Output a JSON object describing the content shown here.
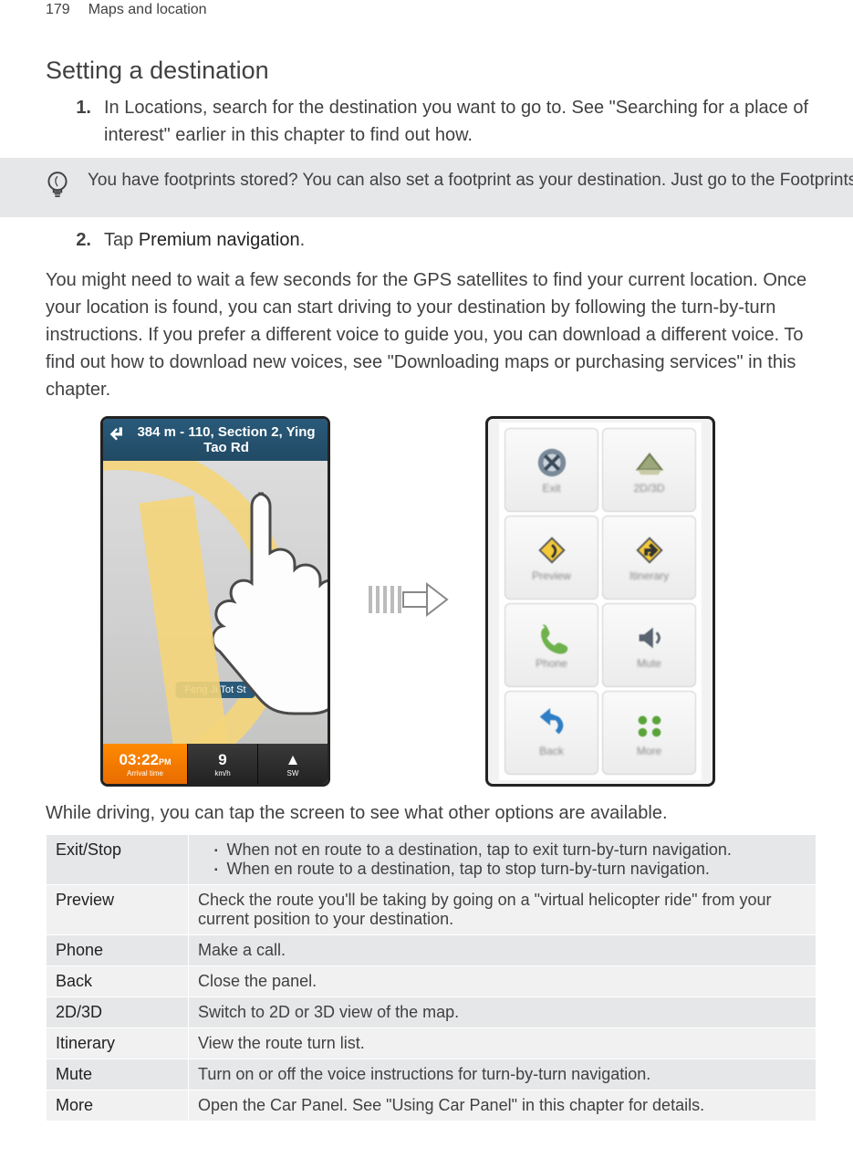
{
  "header": {
    "page_number": "179",
    "chapter": "Maps and location"
  },
  "section_title": "Setting a destination",
  "steps": {
    "s1_num": "1.",
    "s1_text": "In Locations, search for the destination you want to go to. See \"Searching for a place of interest\" earlier in this chapter to find out how.",
    "s2_num": "2.",
    "s2_text_a": "Tap ",
    "s2_text_b": "Premium navigation",
    "s2_text_c": "."
  },
  "tip": "You have footprints stored? You can also set a footprint as your destination. Just go to the Footprints tab, and then choose a footprint.",
  "body_para": "You might need to wait a few seconds for the GPS satellites to find your current location. Once your location is found, you can start driving to your destination by following the turn-by-turn instructions. If you prefer a different voice to guide you, you can download a different voice. To find out how to download new voices, see \"Downloading maps or purchasing services\" in this chapter.",
  "left_phone": {
    "direction": "384 m - 110, Section 2, Ying Tao Rd",
    "street_badge": "Feng Ji Tot St",
    "time": "03:22",
    "time_suffix": "PM",
    "time_label": "Arrival time",
    "speed_value": "9",
    "speed_label": "km/h",
    "compass_value": "▲",
    "compass_label": "SW"
  },
  "right_phone": {
    "cells": {
      "c0": "Exit",
      "c1": "2D/3D",
      "c2": "Preview",
      "c3": "Itinerary",
      "c4": "Phone",
      "c5": "Mute",
      "c6": "Back",
      "c7": "More"
    }
  },
  "caption": "While driving, you can tap the screen to see what other options are available.",
  "table": {
    "r0_label": "Exit/Stop",
    "r0_b1": "When not en route to a destination, tap to exit turn-by-turn navigation.",
    "r0_b2": "When en route to a destination, tap to stop turn-by-turn navigation.",
    "r1_label": "Preview",
    "r1_text": "Check the route you'll be taking by going on a \"virtual helicopter ride\" from your current position to your destination.",
    "r2_label": "Phone",
    "r2_text": "Make a call.",
    "r3_label": "Back",
    "r3_text": "Close the panel.",
    "r4_label": "2D/3D",
    "r4_text": "Switch to 2D or 3D view of the map.",
    "r5_label": "Itinerary",
    "r5_text": "View the route turn list.",
    "r6_label": "Mute",
    "r6_text": "Turn on or off the voice instructions for turn-by-turn navigation.",
    "r7_label": "More",
    "r7_text": "Open the Car Panel. See \"Using Car Panel\" in this chapter for details."
  }
}
